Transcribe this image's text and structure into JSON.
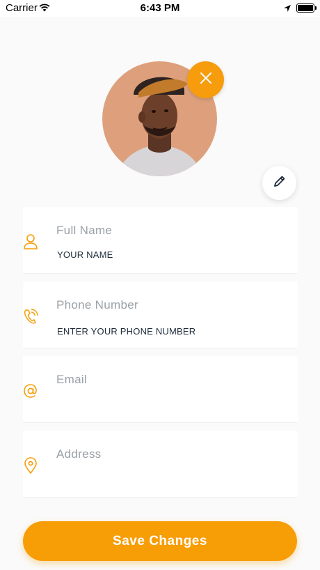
{
  "status_bar": {
    "carrier": "Carrier",
    "time": "6:43 PM"
  },
  "profile": {
    "avatar_alt": "profile photo"
  },
  "fields": [
    {
      "label": "Full Name",
      "value": "YOUR NAME",
      "icon": "user-icon"
    },
    {
      "label": "Phone Number",
      "value": "ENTER YOUR PHONE NUMBER",
      "icon": "phone-icon"
    },
    {
      "label": "Email",
      "value": "",
      "icon": "at-icon"
    },
    {
      "label": "Address",
      "value": "",
      "icon": "location-pin-icon"
    }
  ],
  "save_button": {
    "label": "Save Changes"
  },
  "colors": {
    "accent": "#F79D06",
    "label": "#9AA0A6",
    "value": "#1D2B3A",
    "background": "#FAFAFA"
  }
}
